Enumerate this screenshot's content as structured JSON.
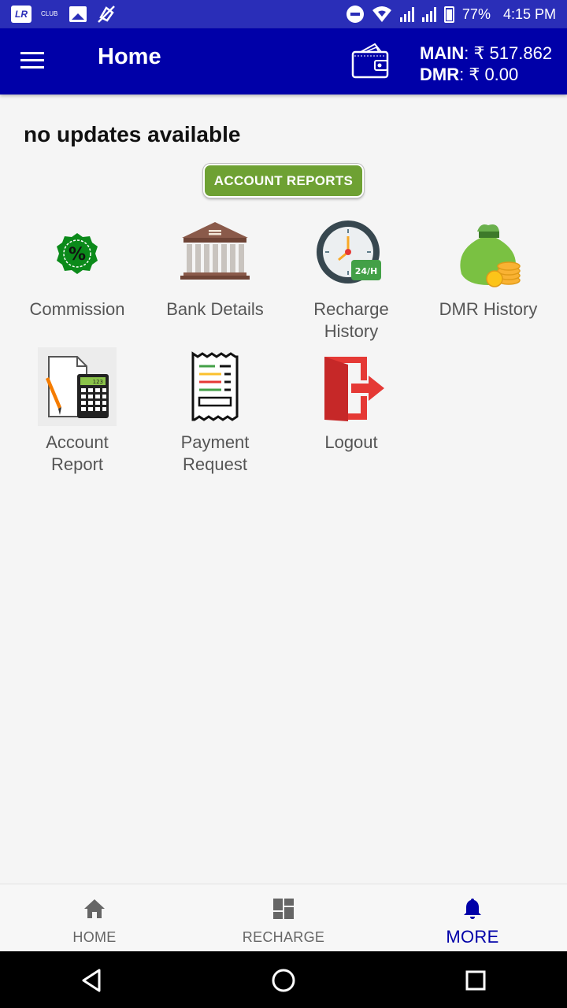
{
  "status_bar": {
    "app_icon_text": "LR",
    "club_text": "CLUB",
    "battery": "77%",
    "time": "4:15 PM"
  },
  "app_bar": {
    "title": "Home",
    "main_label": "MAIN",
    "main_value": ": ₹ 517.862",
    "dmr_label": "DMR",
    "dmr_value": ": ₹ 0.00"
  },
  "content": {
    "updates_text": "no updates available",
    "account_reports_button": "ACCOUNT REPORTS",
    "tiles": [
      {
        "label": "Commission",
        "icon": "percent-badge-icon"
      },
      {
        "label": "Bank Details",
        "icon": "bank-icon"
      },
      {
        "label": "Recharge History",
        "icon": "clock-24h-icon"
      },
      {
        "label": "DMR History",
        "icon": "money-bag-icon"
      },
      {
        "label": "Account Report",
        "icon": "calculator-document-icon"
      },
      {
        "label": "Payment Request",
        "icon": "receipt-icon"
      },
      {
        "label": "Logout",
        "icon": "logout-door-icon"
      }
    ],
    "clock_badge": "24/H",
    "calculator_display": "123"
  },
  "bottom_nav": {
    "items": [
      {
        "label": "HOME",
        "icon": "home-icon"
      },
      {
        "label": "RECHARGE",
        "icon": "dashboard-icon"
      },
      {
        "label": "MORE",
        "icon": "bell-icon",
        "active": true
      }
    ]
  },
  "colors": {
    "app_bar": "#0000a8",
    "status_bar": "#2a2eb8",
    "accent_green": "#6ea133",
    "active_nav": "#0000a8"
  }
}
